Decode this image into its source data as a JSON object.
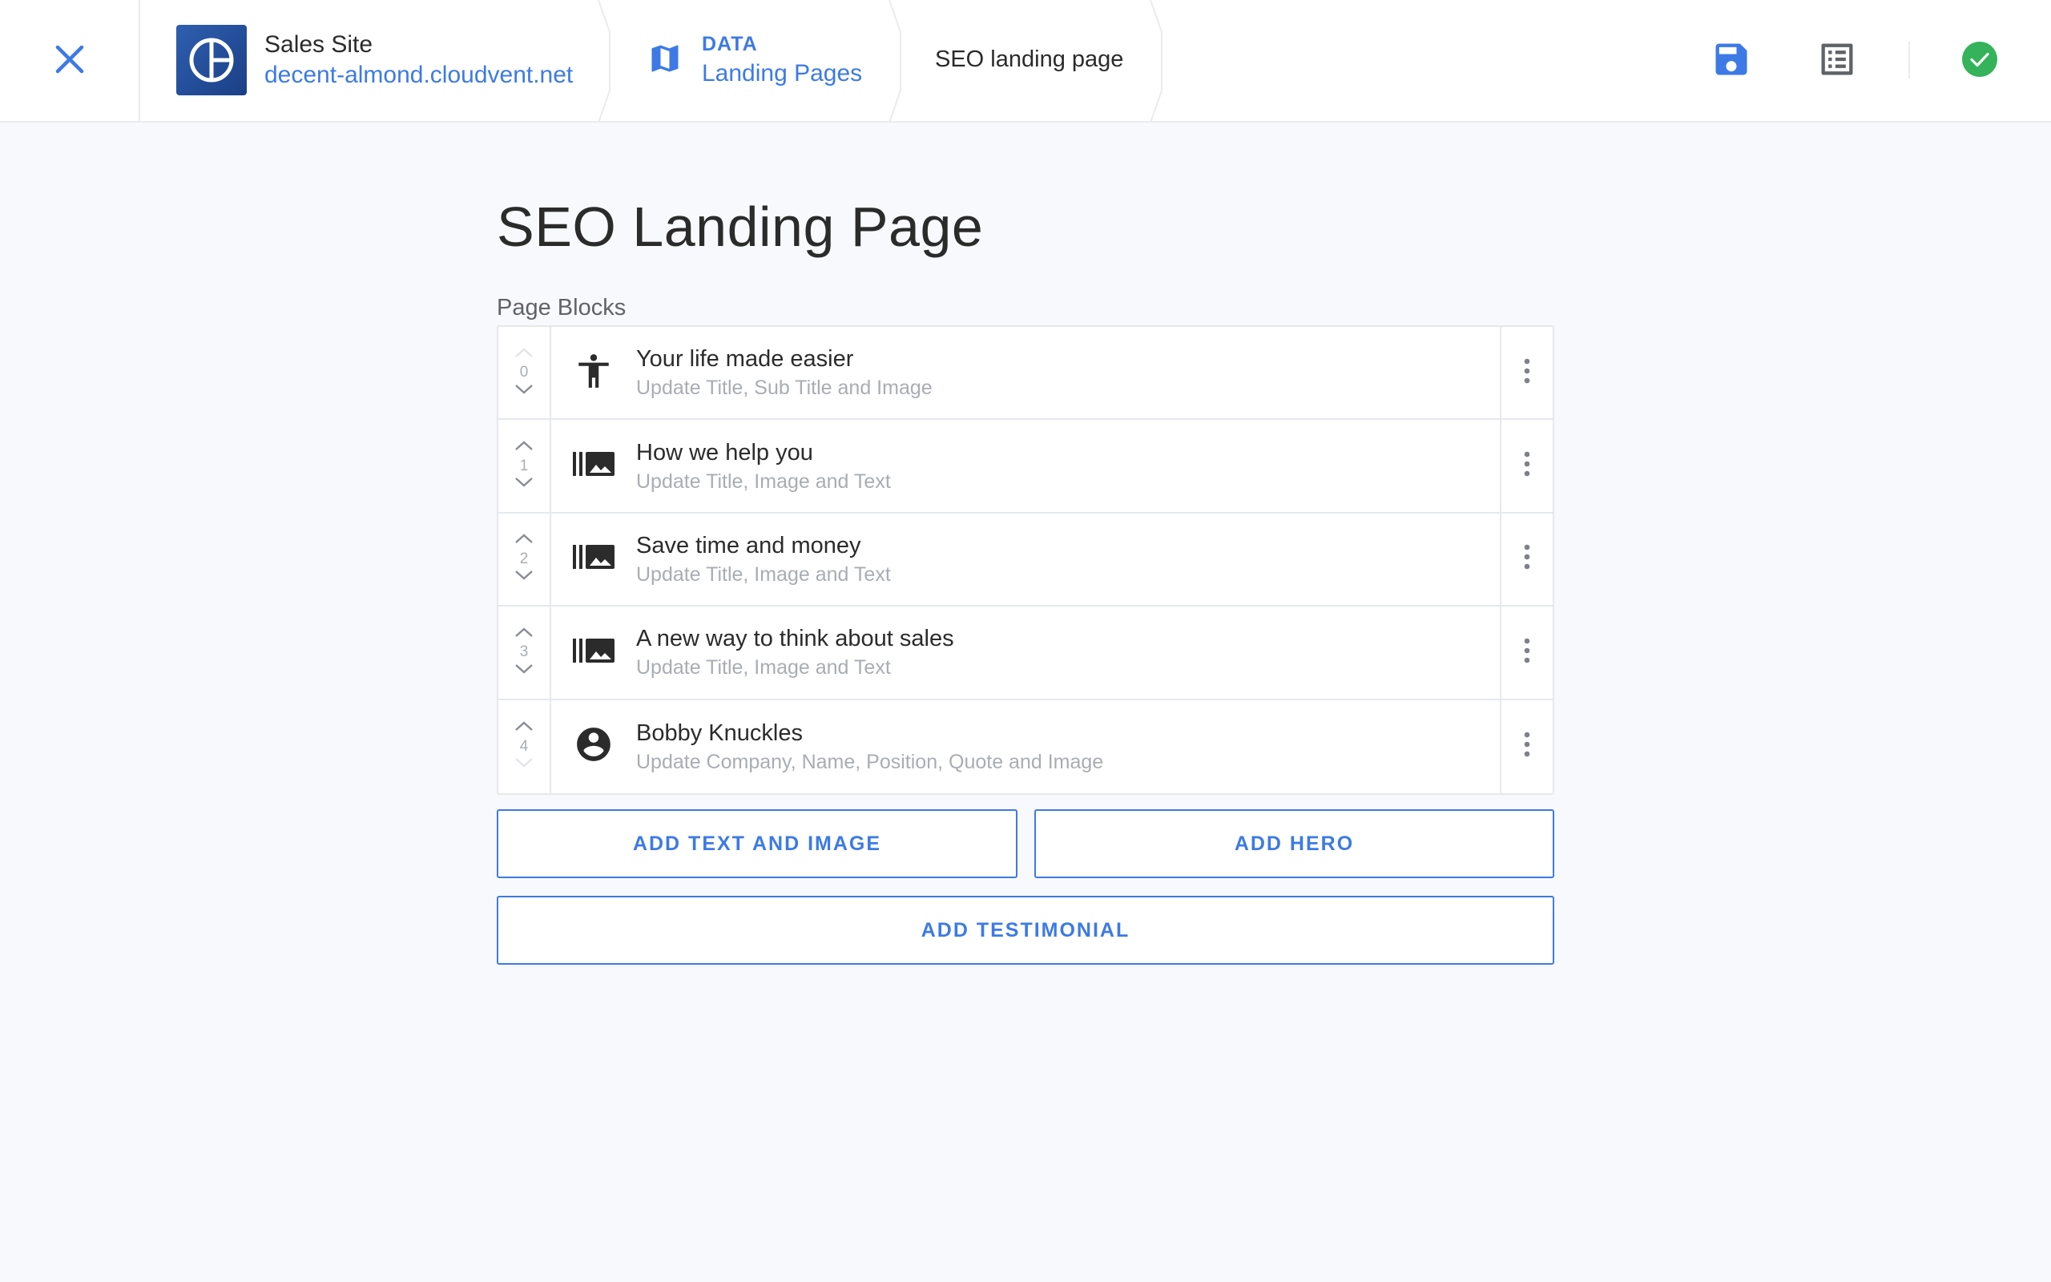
{
  "header": {
    "site_name": "Sales Site",
    "site_url": "decent-almond.cloudvent.net",
    "breadcrumb_kicker": "DATA",
    "breadcrumb_label": "Landing Pages",
    "breadcrumb_current": "SEO landing page",
    "icons": {
      "close": "close-icon",
      "site_logo": "site-logo",
      "map": "map-icon",
      "save": "save-icon",
      "list": "list-icon",
      "status": "check-circle-icon"
    }
  },
  "main": {
    "title": "SEO Landing Page",
    "section_label": "Page Blocks",
    "blocks": [
      {
        "index": "0",
        "title": "Your life made easier",
        "subtitle": "Update Title, Sub Title and Image",
        "icon": "accessibility-icon"
      },
      {
        "index": "1",
        "title": "How we help you",
        "subtitle": "Update Title, Image and Text",
        "icon": "image-gallery-icon"
      },
      {
        "index": "2",
        "title": "Save time and money",
        "subtitle": "Update Title, Image and Text",
        "icon": "image-gallery-icon"
      },
      {
        "index": "3",
        "title": "A new way to think about sales",
        "subtitle": "Update Title, Image and Text",
        "icon": "image-gallery-icon"
      },
      {
        "index": "4",
        "title": "Bobby Knuckles",
        "subtitle": "Update Company, Name, Position, Quote and Image",
        "icon": "account-circle-icon"
      }
    ],
    "buttons": {
      "add_text_and_image": "ADD TEXT AND IMAGE",
      "add_hero": "ADD HERO",
      "add_testimonial": "ADD TESTIMONIAL"
    }
  },
  "colors": {
    "accent": "#3d7ae6",
    "success": "#34b35a",
    "text": "#2b2b2b",
    "muted": "#a9adb3",
    "background": "#f8f9fc"
  }
}
